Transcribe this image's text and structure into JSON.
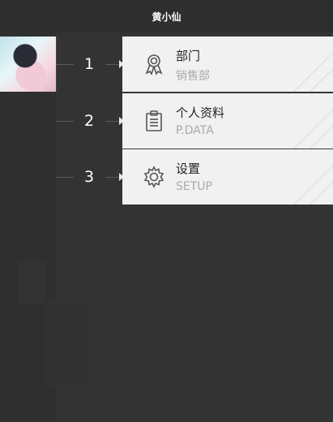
{
  "header": {
    "title": "黄小仙"
  },
  "menu": [
    {
      "number": "1",
      "title": "部门",
      "subtitle": "销售部",
      "icon": "award-icon"
    },
    {
      "number": "2",
      "title": "个人资料",
      "subtitle": "P.DATA",
      "icon": "clipboard-icon"
    },
    {
      "number": "3",
      "title": "设置",
      "subtitle": "SETUP",
      "icon": "gear-icon"
    }
  ]
}
